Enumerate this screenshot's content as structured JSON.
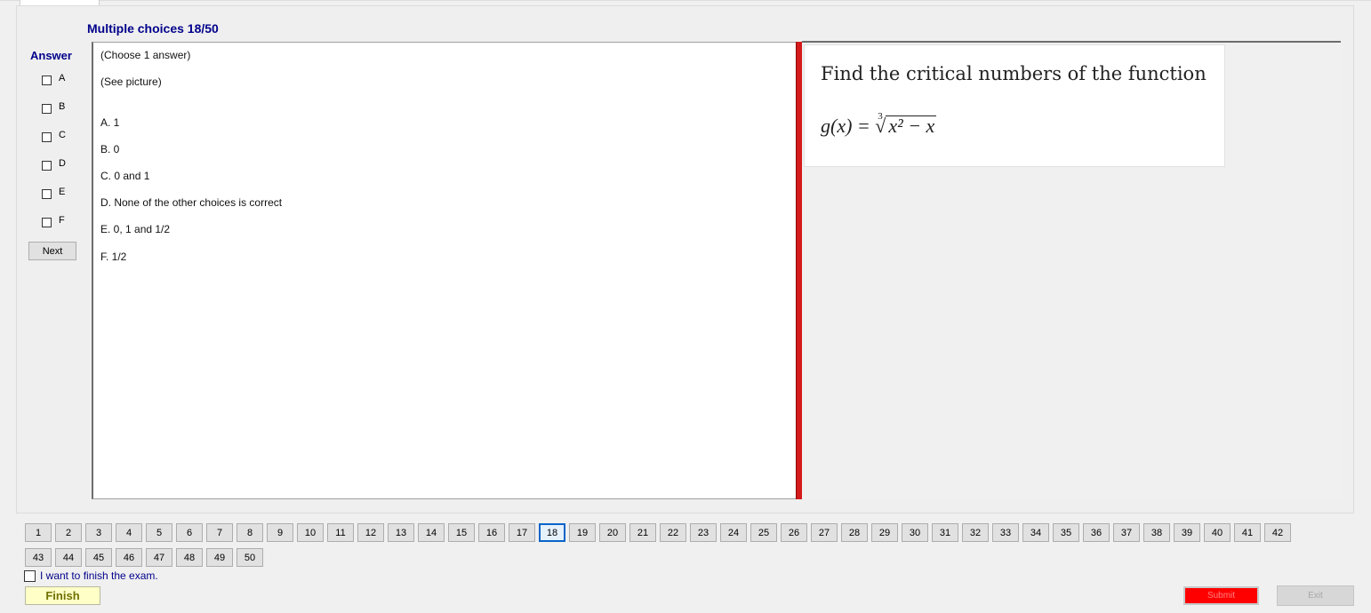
{
  "header": {
    "title": "Multiple choices 18/50"
  },
  "answer_panel": {
    "label": "Answer",
    "options": [
      "A",
      "B",
      "C",
      "D",
      "E",
      "F"
    ],
    "next_label": "Next"
  },
  "question": {
    "instruction": "(Choose 1 answer)",
    "note": "(See picture)",
    "choices": [
      "A.  1",
      "B.  0",
      "C.  0 and 1",
      "D.  None of the other choices is correct",
      "E.  0, 1 and 1/2",
      "F.  1/2"
    ]
  },
  "picture": {
    "line1": "Find the critical numbers of the function",
    "math_lhs": "g(x) = ",
    "math_index": "3",
    "math_radicand": "x² − x"
  },
  "navigation": {
    "current": 18,
    "row1": [
      "1",
      "2",
      "3",
      "4",
      "5",
      "6",
      "7",
      "8",
      "9",
      "10",
      "11",
      "12",
      "13",
      "14",
      "15",
      "16",
      "17",
      "18",
      "19",
      "20",
      "21",
      "22",
      "23",
      "24",
      "25",
      "26",
      "27",
      "28",
      "29",
      "30",
      "31",
      "32",
      "33",
      "34",
      "35",
      "36",
      "37",
      "38",
      "39",
      "40",
      "41",
      "42"
    ],
    "row2": [
      "43",
      "44",
      "45",
      "46",
      "47",
      "48",
      "49",
      "50"
    ]
  },
  "footer": {
    "finish_checkbox_label": "I want to finish the exam.",
    "finish_label": "Finish",
    "submit_label": "Submit",
    "exit_label": "Exit"
  },
  "colors": {
    "title_blue": "#00008b",
    "red_bar": "#d41a1a",
    "current_nav_border": "#0a64c8",
    "finish_bg": "#ffffc8",
    "submit_bg": "#ff0000"
  }
}
